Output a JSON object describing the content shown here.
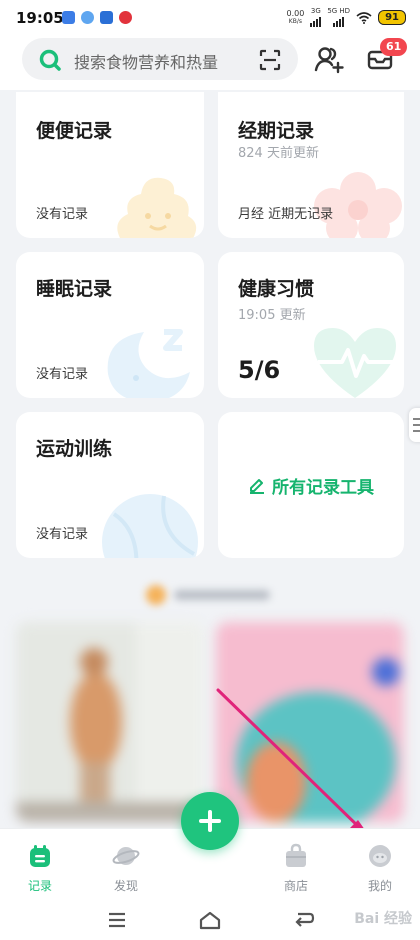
{
  "status_bar": {
    "time": "19:05",
    "net_speed": "0.00",
    "net_unit": "KB/s",
    "sig1_label": "3G",
    "sig2_label": "5G HD",
    "battery": "91"
  },
  "header": {
    "search_placeholder": "搜索食物营养和热量",
    "message_count": "61"
  },
  "cards": {
    "poop": {
      "title": "便便记录",
      "foot": "没有记录"
    },
    "period": {
      "title": "经期记录",
      "sub": "824 天前更新",
      "foot": "月经 近期无记录"
    },
    "sleep": {
      "title": "睡眠记录",
      "foot": "没有记录"
    },
    "habit": {
      "title": "健康习惯",
      "sub": "19:05 更新",
      "value": "5/6"
    },
    "exercise": {
      "title": "运动训练",
      "foot": "没有记录"
    },
    "all_tools": {
      "label": "所有记录工具"
    }
  },
  "tabbar": {
    "tabs": [
      {
        "label": "记录",
        "icon": "calendar-icon"
      },
      {
        "label": "发现",
        "icon": "planet-icon"
      },
      {
        "label": "商店",
        "icon": "bag-icon"
      },
      {
        "label": "我的",
        "icon": "profile-icon"
      }
    ]
  },
  "navbar": {
    "watermark": "Bai 经验"
  },
  "colors": {
    "accent": "#1fc47e",
    "badge": "#f2464f",
    "arrow": "#e0247a"
  }
}
